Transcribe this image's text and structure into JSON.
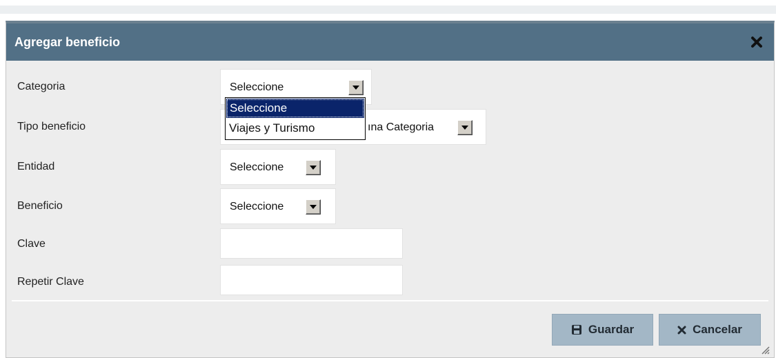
{
  "dialog": {
    "title": "Agregar beneficio",
    "close_icon": "close-icon"
  },
  "form": {
    "categoria": {
      "label": "Categoria",
      "value": "Seleccione"
    },
    "tipo_beneficio": {
      "label": "Tipo beneficio",
      "value": "ına Categoria"
    },
    "entidad": {
      "label": "Entidad",
      "value": "Seleccione"
    },
    "beneficio": {
      "label": "Beneficio",
      "value": "Seleccione"
    },
    "clave": {
      "label": "Clave",
      "value": ""
    },
    "repetir_clave": {
      "label": "Repetir Clave",
      "value": ""
    }
  },
  "dropdown": {
    "options": [
      "Seleccione",
      "Viajes y Turismo"
    ],
    "selected": "Seleccione"
  },
  "buttons": {
    "guardar": {
      "label": "Guardar",
      "icon": "save-icon"
    },
    "cancelar": {
      "label": "Cancelar",
      "icon": "close-icon"
    }
  },
  "colors": {
    "titlebar": "#527086",
    "button": "#a3b7c6",
    "dialog_bg": "#ededed",
    "selected_option": "#0a246a"
  }
}
